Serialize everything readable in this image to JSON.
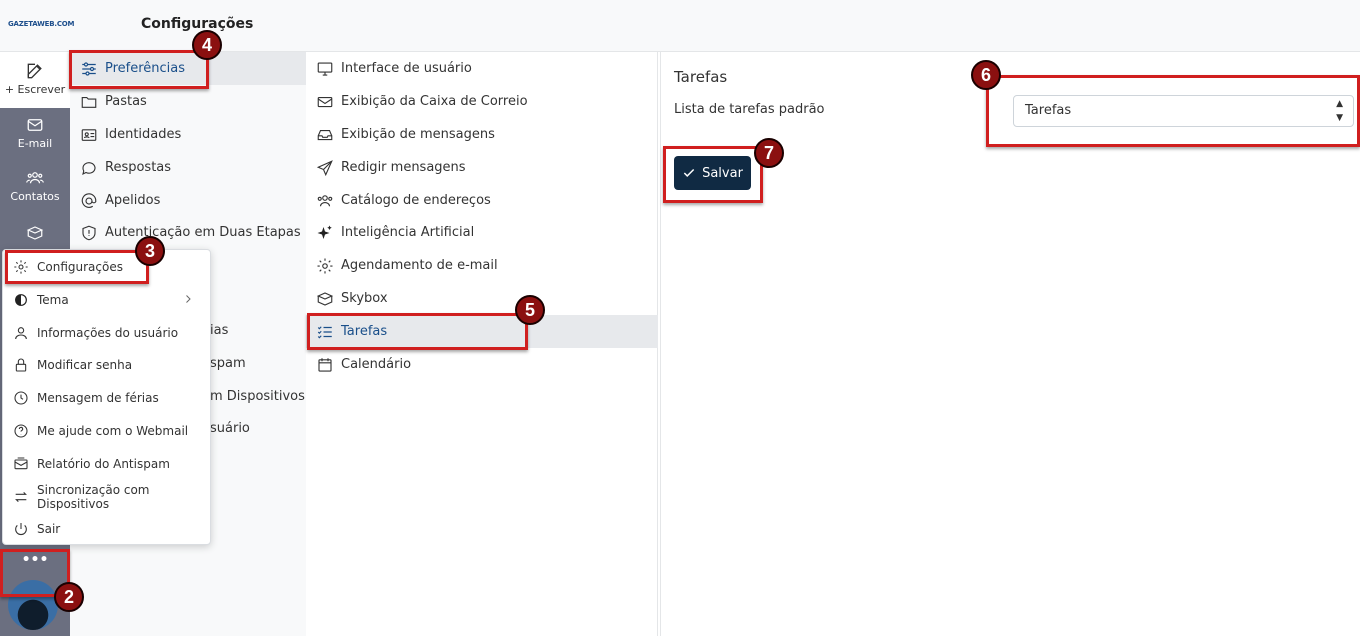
{
  "header": {
    "logo_text": "GAZETAWEB.COM",
    "title": "Configurações"
  },
  "leftnav": {
    "compose_label": "+ Escrever",
    "items": [
      {
        "label": "E-mail",
        "icon": "mail-icon"
      },
      {
        "label": "Contatos",
        "icon": "contacts-icon"
      },
      {
        "label": "",
        "icon": "skybox-icon"
      }
    ],
    "more_label": "•••"
  },
  "sections": {
    "items": [
      {
        "label": "Preferências",
        "icon": "sliders-icon"
      },
      {
        "label": "Pastas",
        "icon": "folder-icon"
      },
      {
        "label": "Identidades",
        "icon": "id-card-icon"
      },
      {
        "label": "Respostas",
        "icon": "chat-icon"
      },
      {
        "label": "Apelidos",
        "icon": "at-icon"
      },
      {
        "label": "Autenticação em Duas Etapas",
        "icon": "shield-icon"
      }
    ],
    "hidden_items": [
      {
        "label": "ias"
      },
      {
        "label": "spam"
      },
      {
        "label": "m Dispositivos"
      },
      {
        "label": "suário"
      }
    ]
  },
  "preferences": {
    "items": [
      {
        "label": "Interface de usuário",
        "icon": "monitor-icon"
      },
      {
        "label": "Exibição da Caixa de Correio",
        "icon": "envelope-icon"
      },
      {
        "label": "Exibição de mensagens",
        "icon": "inbox-icon"
      },
      {
        "label": "Redigir mensagens",
        "icon": "send-icon"
      },
      {
        "label": "Catálogo de endereços",
        "icon": "users-icon"
      },
      {
        "label": "Inteligência Artificial",
        "icon": "sparkles-icon"
      },
      {
        "label": "Agendamento de e-mail",
        "icon": "gear-icon"
      },
      {
        "label": "Skybox",
        "icon": "box-icon"
      },
      {
        "label": "Tarefas",
        "icon": "tasks-icon"
      },
      {
        "label": "Calendário",
        "icon": "calendar-icon"
      }
    ]
  },
  "content": {
    "title": "Tarefas",
    "field_label": "Lista de tarefas padrão",
    "select_value": "Tarefas",
    "save_label": "Salvar"
  },
  "menu": {
    "items": [
      {
        "label": "Configurações",
        "icon": "gear-icon"
      },
      {
        "label": "Tema",
        "icon": "contrast-icon"
      },
      {
        "label": "Informações do usuário",
        "icon": "user-icon"
      },
      {
        "label": "Modificar senha",
        "icon": "lock-icon"
      },
      {
        "label": "Mensagem de férias",
        "icon": "clock-icon"
      },
      {
        "label": "Me ajude com o Webmail",
        "icon": "help-icon"
      },
      {
        "label": "Relatório do Antispam",
        "icon": "report-icon"
      },
      {
        "label": "Sincronização com Dispositivos",
        "icon": "sync-icon"
      },
      {
        "label": "Sair",
        "icon": "power-icon"
      }
    ]
  },
  "annotations": {
    "colors": {
      "highlight": "#d01f1f",
      "badge": "#8b1010"
    },
    "badges": [
      "2",
      "3",
      "4",
      "5",
      "6",
      "7"
    ]
  }
}
